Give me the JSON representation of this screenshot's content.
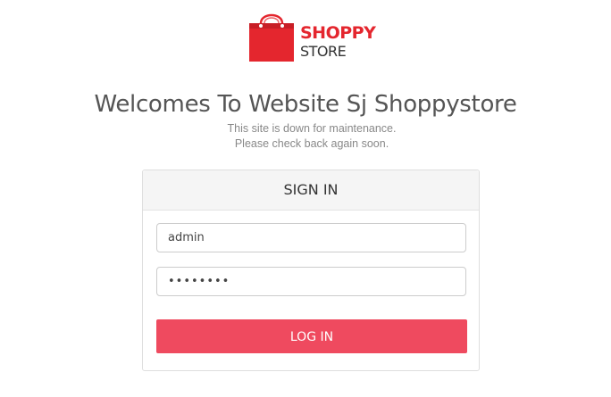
{
  "logo": {
    "line1": "SHOPPY",
    "line2": "STORE",
    "icon": "shopping-bag-icon"
  },
  "heading": "Welcomes To Website Sj Shoppystore",
  "message": {
    "line1": "This site is down for maintenance.",
    "line2": "Please check back again soon."
  },
  "login": {
    "title": "SIGN IN",
    "username_value": "admin",
    "password_mask": "••••••••",
    "submit_label": "LOG IN"
  },
  "colors": {
    "brand_red": "#e4262e",
    "button": "#ef4a5f"
  }
}
